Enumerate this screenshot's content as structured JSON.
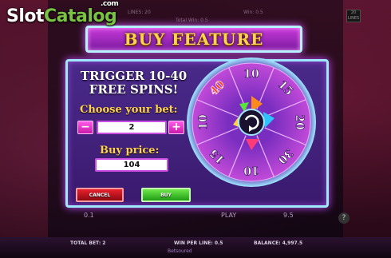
{
  "logo": {
    "part1": "Slot",
    "part2": "Catalog",
    "suffix": ".com"
  },
  "background": {
    "lines_label": "LINES: 20",
    "total_win_label": "Total Win: 0.5",
    "win_label": "Win: 0.5",
    "lines_badge": "20 LINES",
    "bet_value_left": "0.1",
    "play_label": "PLAY",
    "bet_value_right": "9.5",
    "help": "?"
  },
  "dialog": {
    "title": "BUY FEATURE",
    "trigger_line1": "TRIGGER 10-40",
    "trigger_line2": "FREE SPINS!",
    "choose_bet_label": "Choose your bet:",
    "minus": "−",
    "plus": "+",
    "bet_value": "2",
    "buy_price_label": "Buy price:",
    "buy_price_value": "104",
    "cancel_label": "CANCEL",
    "buy_label": "BUY"
  },
  "wheel": {
    "segments": [
      "10",
      "15",
      "20",
      "30",
      "10",
      "15",
      "10",
      "40"
    ],
    "colors": {
      "ring": "#c24ad8",
      "rim": "#9fe8ff",
      "center": "#1a1030",
      "text": "#ffffff",
      "highlight": "#ff3b1f"
    }
  },
  "bottom": {
    "total_bet": "TOTAL BET: 2",
    "win_per_line": "WIN PER LINE: 0.5",
    "balance": "BALANCE: 4,997.5",
    "brand": "Betsoured"
  },
  "colors": {
    "title_gold": "#ffd34a",
    "panel_purple": "#3a1a6e",
    "cancel_red": "#e8202c",
    "buy_green": "#3cc42a"
  }
}
